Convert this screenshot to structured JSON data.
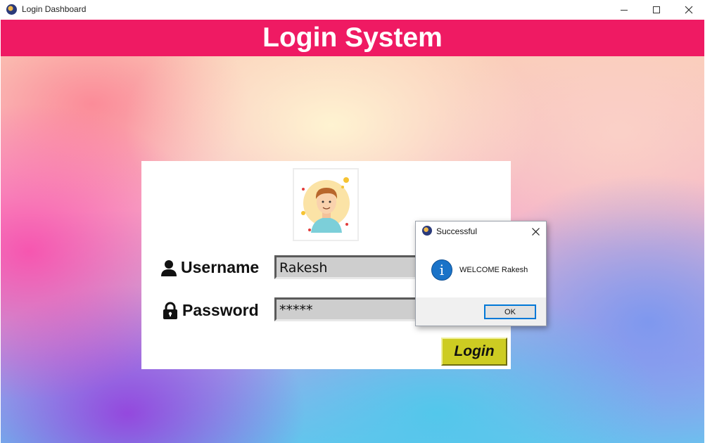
{
  "window": {
    "title": "Login Dashboard"
  },
  "header": {
    "title": "Login System"
  },
  "login_form": {
    "username_label": "Username",
    "password_label": "Password",
    "username_value": "Rakesh",
    "password_value": "*****",
    "login_button": "Login"
  },
  "dialog": {
    "title": "Successful",
    "message": "WELCOME Rakesh",
    "ok_button": "OK"
  },
  "colors": {
    "header_bg": "#ef1a63",
    "login_button_bg": "#cdcc22",
    "info_icon": "#1a73c8",
    "dialog_focus_border": "#0078d7"
  },
  "icons": {
    "app": "app-logo-icon",
    "user": "user-icon",
    "lock": "lock-icon",
    "info": "info-icon",
    "avatar": "user-avatar-illustration"
  }
}
